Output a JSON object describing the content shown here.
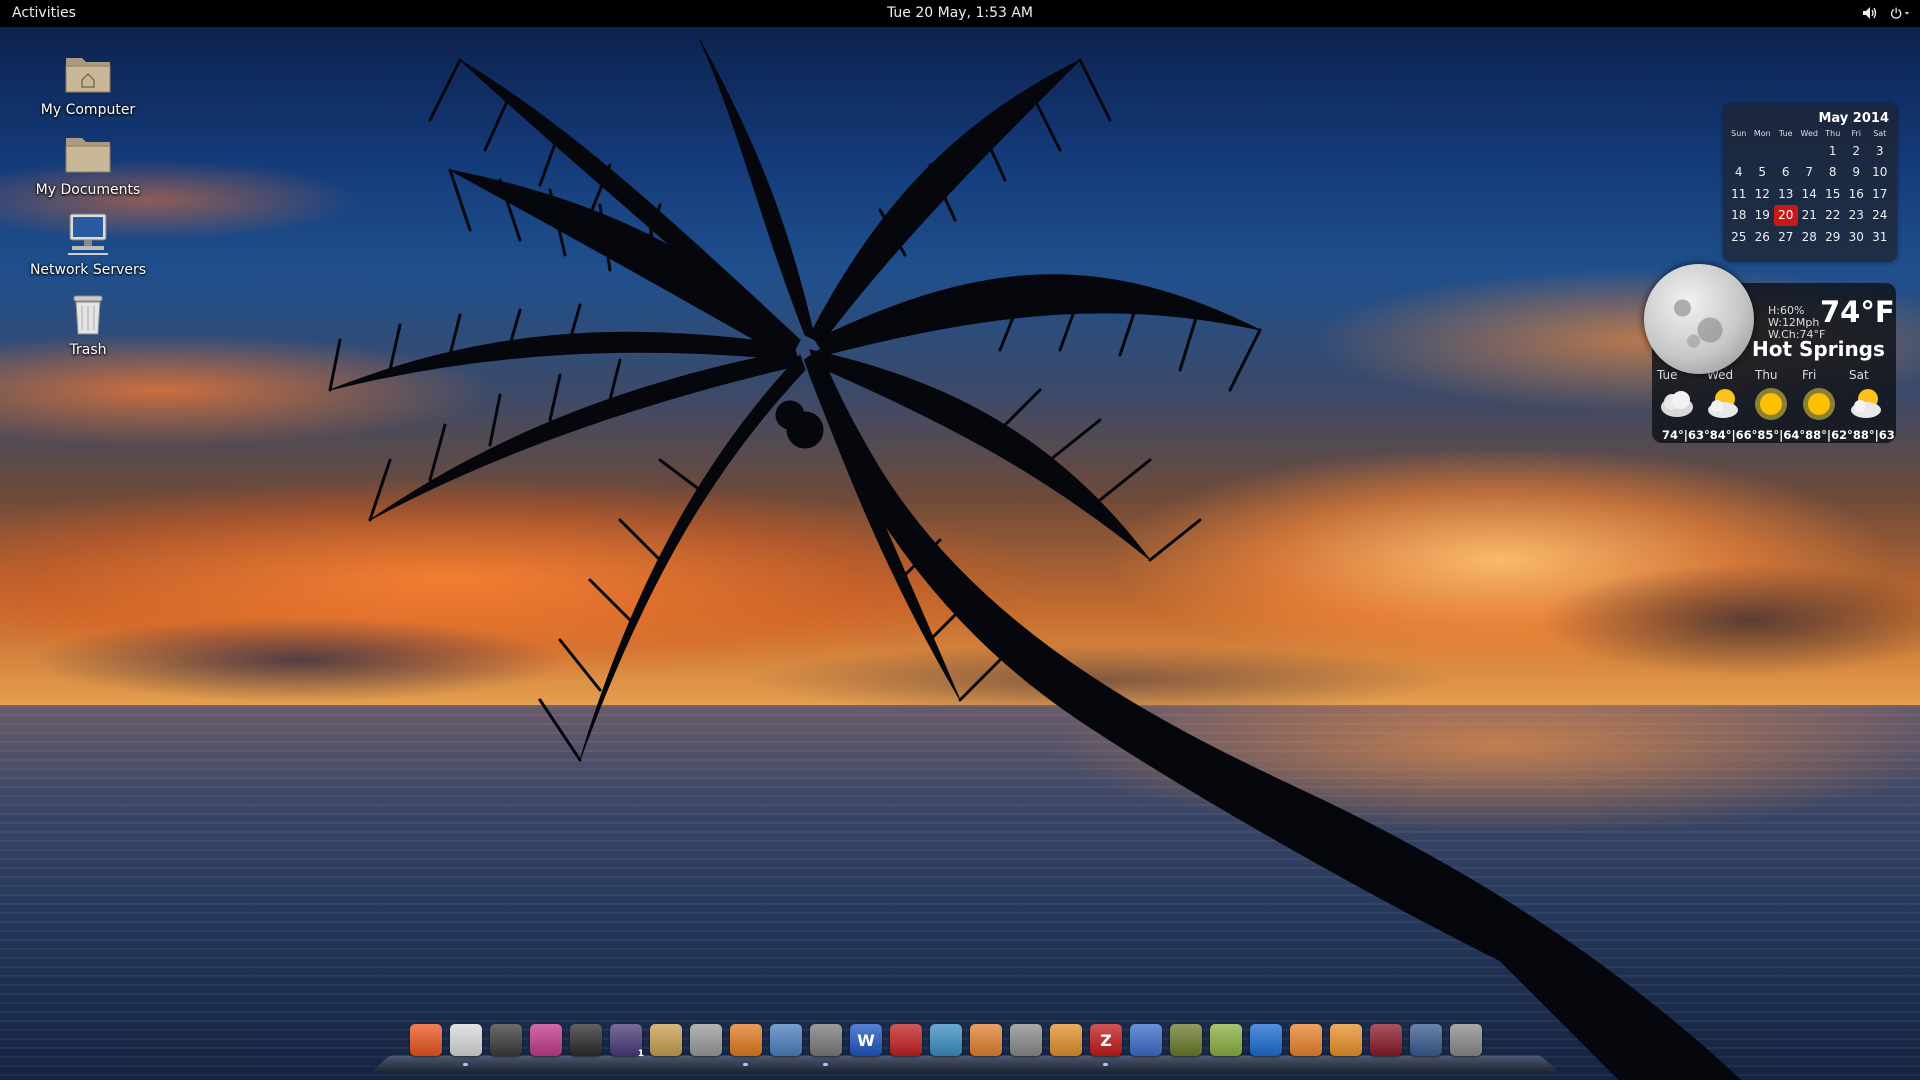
{
  "topbar": {
    "activities": "Activities",
    "clock": "Tue 20 May,  1:53 AM"
  },
  "desktop_icons": [
    {
      "label": "My Computer",
      "icon": "home-folder-icon"
    },
    {
      "label": "My Documents",
      "icon": "folder-icon"
    },
    {
      "label": "Network Servers",
      "icon": "network-computer-icon"
    },
    {
      "label": "Trash",
      "icon": "trash-icon"
    }
  ],
  "calendar": {
    "month": "May 2014",
    "weekdays": [
      "Sun",
      "Mon",
      "Tue",
      "Wed",
      "Thu",
      "Fri",
      "Sat"
    ],
    "weeks": [
      [
        "",
        "",
        "",
        "",
        "1",
        "2",
        "3"
      ],
      [
        "4",
        "5",
        "6",
        "7",
        "8",
        "9",
        "10"
      ],
      [
        "11",
        "12",
        "13",
        "14",
        "15",
        "16",
        "17"
      ],
      [
        "18",
        "19",
        "20",
        "21",
        "22",
        "23",
        "24"
      ],
      [
        "25",
        "26",
        "27",
        "28",
        "29",
        "30",
        "31"
      ]
    ],
    "today": "20",
    "today_color": "#c81818"
  },
  "weather": {
    "humidity": "H:60%",
    "wind": "W:12Mph",
    "wind_chill": "W.Ch:74°F",
    "temperature": "74°F",
    "city": "Hot Springs",
    "days": [
      "Tue",
      "Wed",
      "Thu",
      "Fri",
      "Sat"
    ],
    "conditions": [
      "cloudy-icon",
      "partly-cloudy-icon",
      "sunny-icon",
      "sunny-icon",
      "partly-cloudy-icon"
    ],
    "temps": "74°|63°84°|66°85°|64°88°|62°88°|63"
  },
  "dock": {
    "items": [
      {
        "name": "ubuntu-icon",
        "color": "#e95420"
      },
      {
        "name": "file-manager-icon",
        "color": "#d9d9d9"
      },
      {
        "name": "system-monitor-icon",
        "color": "#3a3a3a"
      },
      {
        "name": "screenshot-icon",
        "color": "#c03a8a"
      },
      {
        "name": "terminal-icon",
        "color": "#2b2b2b"
      },
      {
        "name": "workspace-switcher-icon",
        "color": "#4a3a7a",
        "badge": "1"
      },
      {
        "name": "archive-manager-icon",
        "color": "#c8a050"
      },
      {
        "name": "text-editor-icon",
        "color": "#9a9a9a"
      },
      {
        "name": "firefox-icon",
        "color": "#e07a20"
      },
      {
        "name": "document-viewer-icon",
        "color": "#4a7fc0"
      },
      {
        "name": "image-viewer-icon",
        "color": "#7a7a7a"
      },
      {
        "name": "word-processor-icon",
        "color": "#1f56c0",
        "text": "W"
      },
      {
        "name": "pdf-reader-icon",
        "color": "#c02020"
      },
      {
        "name": "spreadsheet-icon",
        "color": "#3a8ec0"
      },
      {
        "name": "folder-orange-icon",
        "color": "#e08030"
      },
      {
        "name": "calculator-icon",
        "color": "#8a8a8a"
      },
      {
        "name": "sublime-text-icon",
        "color": "#e0902a"
      },
      {
        "name": "filezilla-icon",
        "color": "#c01a1a",
        "text": "Z"
      },
      {
        "name": "qbittorrent-icon",
        "color": "#3a6cc8"
      },
      {
        "name": "plant-app-icon",
        "color": "#6a7a2a"
      },
      {
        "name": "gimp-palette-icon",
        "color": "#8ab040"
      },
      {
        "name": "teamviewer-icon",
        "color": "#1a6cd0"
      },
      {
        "name": "home-folder-icon",
        "color": "#e8822a"
      },
      {
        "name": "backup-icon",
        "color": "#e8902a"
      },
      {
        "name": "ruby-app-icon",
        "color": "#8a1a2a"
      },
      {
        "name": "accessibility-icon",
        "color": "#3a5a90"
      },
      {
        "name": "shutdown-icon",
        "color": "#8a8a8a"
      }
    ]
  }
}
